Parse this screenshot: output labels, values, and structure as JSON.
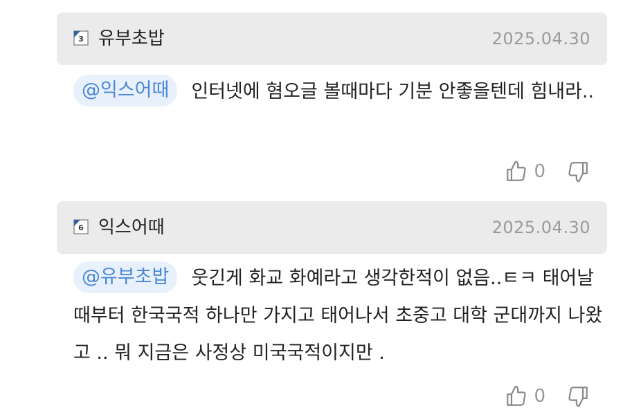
{
  "comments": [
    {
      "level": "3",
      "username": "유부초밥",
      "date": "2025.04.30",
      "mention": "@익스어때",
      "text": "인터넷에 혐오글 볼때마다 기분 안좋을텐데 힘내라..",
      "likes": "0",
      "level_color": "#2f5fa0"
    },
    {
      "level": "6",
      "username": "익스어때",
      "date": "2025.04.30",
      "mention": "@유부초밥",
      "text": "웃긴게 화교 화예라고 생각한적이 없음..ㅌㅋ 태어날때부터 한국국적 하나만 가지고 태어나서 초중고 대학 군대까지 나왔고 .. 뭐 지금은 사정상 미국국적이지만 .",
      "likes": "0",
      "level_color": "#2f5fa0"
    }
  ],
  "icons": {
    "like": "thumbs-up-icon",
    "dislike": "thumbs-down-icon"
  }
}
